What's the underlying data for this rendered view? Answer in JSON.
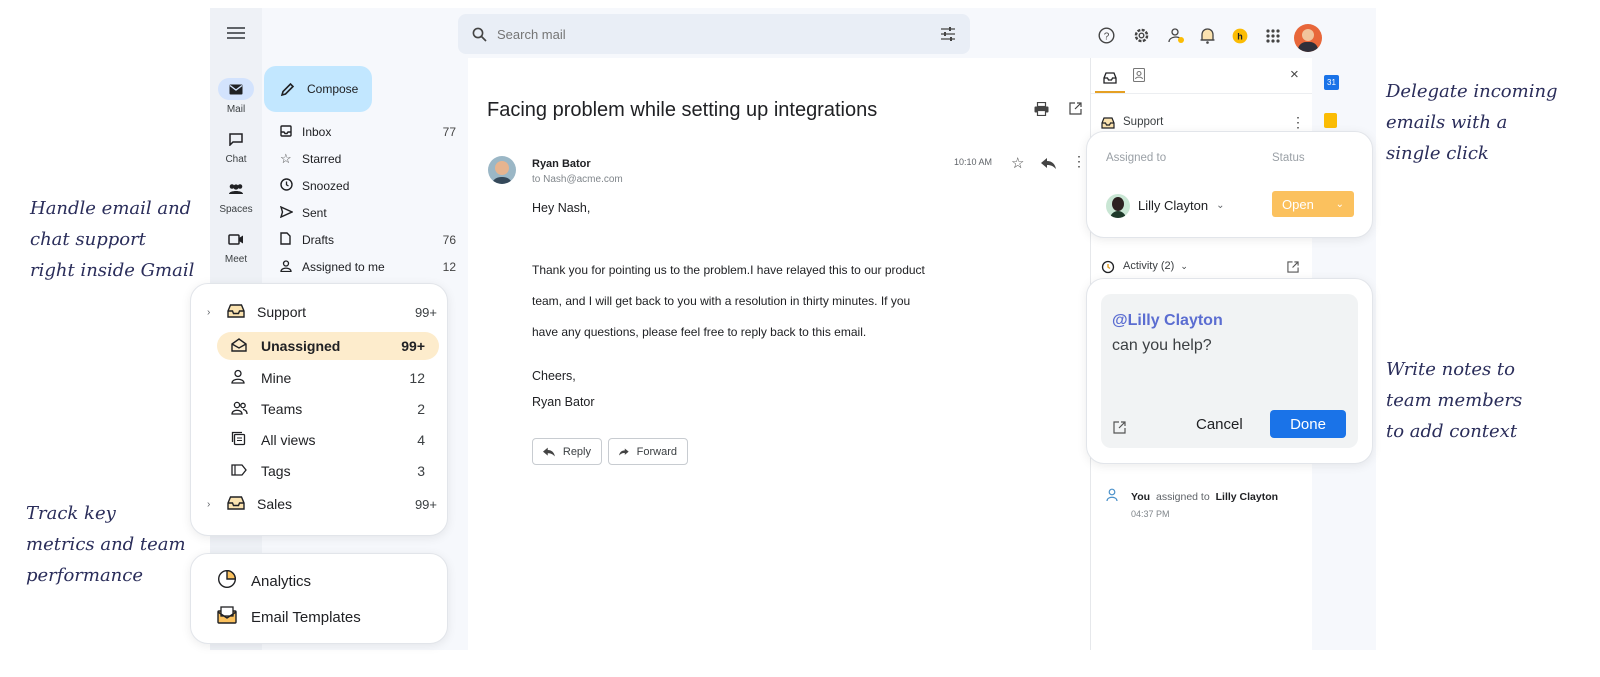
{
  "annotations": {
    "handle_lines": [
      "Handle email and",
      "chat support",
      "right inside Gmail"
    ],
    "track_lines": [
      "Track key",
      "metrics and team",
      "performance"
    ],
    "delegate_lines": [
      "Delegate incoming",
      "emails with a",
      "single click"
    ],
    "notes_lines": [
      "Write notes to",
      "team members",
      "to add context"
    ]
  },
  "search": {
    "placeholder": "Search mail"
  },
  "rail": [
    {
      "label": "Mail",
      "icon": "mail-icon"
    },
    {
      "label": "Chat",
      "icon": "chat-icon"
    },
    {
      "label": "Spaces",
      "icon": "spaces-icon"
    },
    {
      "label": "Meet",
      "icon": "meet-icon"
    }
  ],
  "compose_label": "Compose",
  "nav": [
    {
      "label": "Inbox",
      "count": "77",
      "icon": "inbox-icon"
    },
    {
      "label": "Starred",
      "count": "",
      "icon": "star-icon"
    },
    {
      "label": "Snoozed",
      "count": "",
      "icon": "clock-icon"
    },
    {
      "label": "Sent",
      "count": "",
      "icon": "send-icon"
    },
    {
      "label": "Drafts",
      "count": "76",
      "icon": "draft-icon"
    },
    {
      "label": "Assigned to me",
      "count": "12",
      "icon": "person-icon"
    }
  ],
  "inbox_popup": {
    "support": {
      "label": "Support",
      "count": "99+"
    },
    "items": [
      {
        "label": "Unassigned",
        "count": "99+",
        "icon": "open-envelope-icon",
        "active": true
      },
      {
        "label": "Mine",
        "count": "12",
        "icon": "person-icon"
      },
      {
        "label": "Teams",
        "count": "2",
        "icon": "people-icon"
      },
      {
        "label": "All views",
        "count": "4",
        "icon": "views-icon"
      },
      {
        "label": "Tags",
        "count": "3",
        "icon": "tag-icon"
      }
    ],
    "sales": {
      "label": "Sales",
      "count": "99+"
    }
  },
  "bottom_popup": {
    "analytics": "Analytics",
    "templates": "Email Templates"
  },
  "email": {
    "subject": "Facing problem while setting up integrations",
    "sender": "Ryan Bator",
    "to": "to Nash@acme.com",
    "time": "10:10 AM",
    "greeting": "Hey Nash,",
    "body_lines": [
      "Thank you for pointing us to the problem.I have relayed this to our product",
      "team, and I will get back to you with a resolution in thirty minutes. If you",
      "have any questions, please feel free to reply back to this email."
    ],
    "signoff": "Cheers,",
    "signature": "Ryan Bator",
    "reply": "Reply",
    "forward": "Forward"
  },
  "side_panel": {
    "inbox_name": "Support",
    "assigned_to_label": "Assigned to",
    "status_label": "Status",
    "assignee": "Lilly Clayton",
    "status": "Open",
    "activity": "Activity (2)",
    "note_mention": "@Lilly Clayton",
    "note_text": "can you help?",
    "cancel": "Cancel",
    "done": "Done",
    "log_actor": "You",
    "log_action": "assigned to",
    "log_target": "Lilly Clayton",
    "log_time": "04:37 PM"
  },
  "calendar_day": "31",
  "colors": {
    "accent_blue": "#1a73e8",
    "status_orange": "#fbc15e",
    "compose_bg": "#c2e7ff",
    "active_row": "#fdeccc",
    "mention": "#5b6dd1"
  }
}
